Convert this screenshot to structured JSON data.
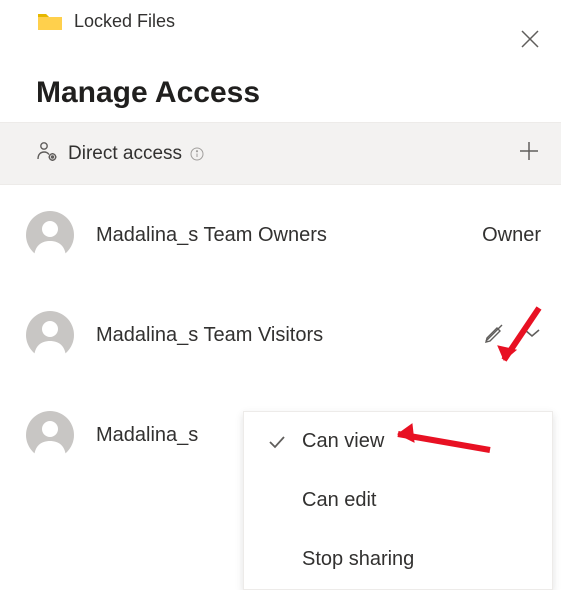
{
  "header": {
    "folder_name": "Locked Files"
  },
  "title": "Manage Access",
  "direct_access": {
    "label": "Direct access"
  },
  "members": [
    {
      "name": "Madalina_s Team Owners",
      "role": "Owner"
    },
    {
      "name": "Madalina_s Team Visitors",
      "role": "Can view"
    },
    {
      "name": "Madalina_s Team Members",
      "role": ""
    }
  ],
  "dropdown": {
    "options": [
      {
        "label": "Can view",
        "selected": true
      },
      {
        "label": "Can edit",
        "selected": false
      },
      {
        "label": "Stop sharing",
        "selected": false
      }
    ]
  },
  "colors": {
    "highlight": "#e81123",
    "bg_section": "#f3f2f1"
  }
}
